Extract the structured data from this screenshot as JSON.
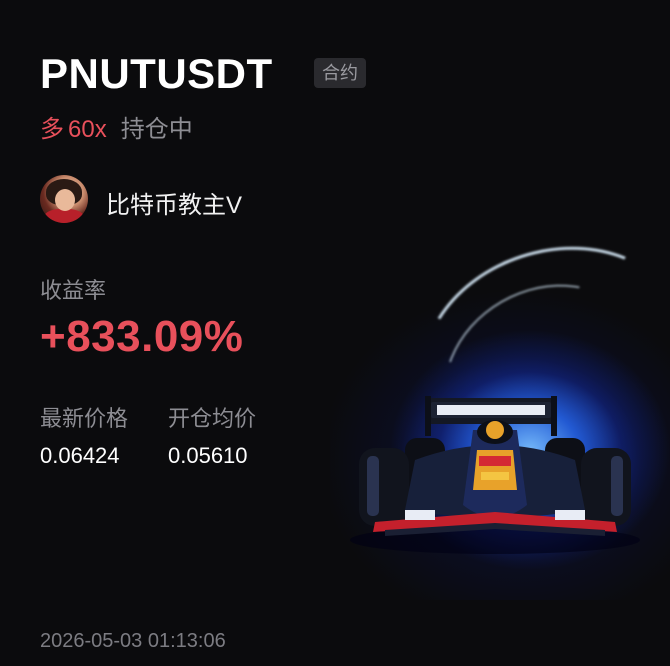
{
  "header": {
    "symbol": "PNUTUSDT",
    "contract_tag": "合约"
  },
  "position": {
    "direction": "多",
    "leverage": "60x",
    "status": "持仓中"
  },
  "trader": {
    "name": "比特币教主V"
  },
  "stats": {
    "yield_label": "收益率",
    "yield_value": "+833.09%",
    "latest_price_label": "最新价格",
    "latest_price_value": "0.06424",
    "open_price_label": "开仓均价",
    "open_price_value": "0.05610"
  },
  "footer": {
    "timestamp": "2026-05-03 01:13:06"
  },
  "colors": {
    "profit_red": "#e8505b",
    "muted_gray": "#8d8d93",
    "background": "#0b0b0d",
    "glow_blue": "#2a6cff"
  },
  "icons": {
    "avatar": "user-avatar",
    "illustration": "f1-racecar-illustration"
  }
}
